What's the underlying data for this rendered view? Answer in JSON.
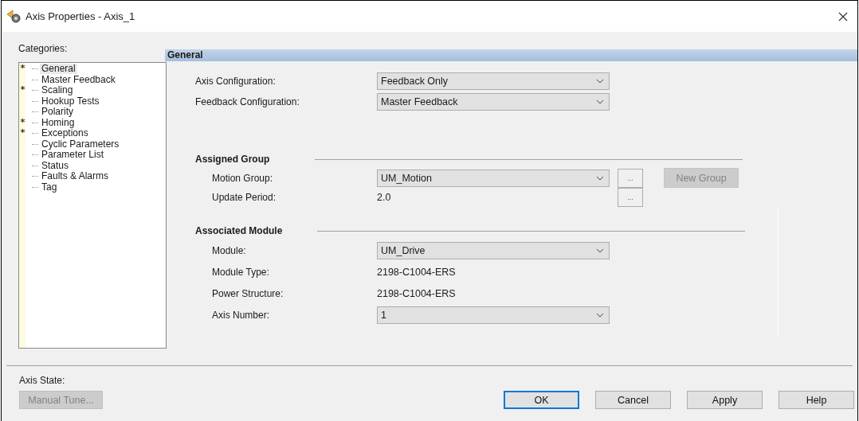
{
  "window": {
    "title": "Axis Properties - Axis_1"
  },
  "categories": {
    "label": "Categories:",
    "items": [
      {
        "label": "General",
        "starred": true,
        "selected": true
      },
      {
        "label": "Master Feedback",
        "starred": false,
        "selected": false
      },
      {
        "label": "Scaling",
        "starred": true,
        "selected": false
      },
      {
        "label": "Hookup Tests",
        "starred": false,
        "selected": false
      },
      {
        "label": "Polarity",
        "starred": false,
        "selected": false
      },
      {
        "label": "Homing",
        "starred": true,
        "selected": false
      },
      {
        "label": "Exceptions",
        "starred": true,
        "selected": false
      },
      {
        "label": "Cyclic Parameters",
        "starred": false,
        "selected": false
      },
      {
        "label": "Parameter List",
        "starred": false,
        "selected": false
      },
      {
        "label": "Status",
        "starred": false,
        "selected": false
      },
      {
        "label": "Faults & Alarms",
        "starred": false,
        "selected": false
      },
      {
        "label": "Tag",
        "starred": false,
        "selected": false
      }
    ]
  },
  "panel": {
    "title": "General",
    "fields": [
      {
        "kind": "dropdown",
        "label": "Axis Configuration:",
        "value": "Feedback Only"
      },
      {
        "kind": "dropdown",
        "label": "Feedback Configuration:",
        "value": "Master Feedback"
      }
    ],
    "sections": [
      {
        "title": "Assigned Group",
        "fields": [
          {
            "kind": "dropdown",
            "label": "Motion Group:",
            "value": "UM_Motion",
            "browse": "...",
            "extra": {
              "label": "New Group",
              "disabled": true
            }
          },
          {
            "kind": "text",
            "label": "Update Period:",
            "value": "2.0",
            "browse": "..."
          }
        ]
      },
      {
        "title": "Associated Module",
        "fields": [
          {
            "kind": "dropdown",
            "label": "Module:",
            "value": "UM_Drive"
          },
          {
            "kind": "text",
            "label": "Module Type:",
            "value": "2198-C1004-ERS"
          },
          {
            "kind": "text",
            "label": "Power Structure:",
            "value": "2198-C1004-ERS"
          },
          {
            "kind": "dropdown",
            "label": "Axis Number:",
            "value": "1"
          }
        ]
      }
    ]
  },
  "axis_state": {
    "label": "Axis State:"
  },
  "buttons": [
    {
      "label": "Manual Tune...",
      "disabled": true,
      "default": false
    },
    {
      "label": "OK",
      "disabled": false,
      "default": true
    },
    {
      "label": "Cancel",
      "disabled": false,
      "default": false
    },
    {
      "label": "Apply",
      "disabled": false,
      "default": false
    },
    {
      "label": "Help",
      "disabled": false,
      "default": false
    }
  ]
}
